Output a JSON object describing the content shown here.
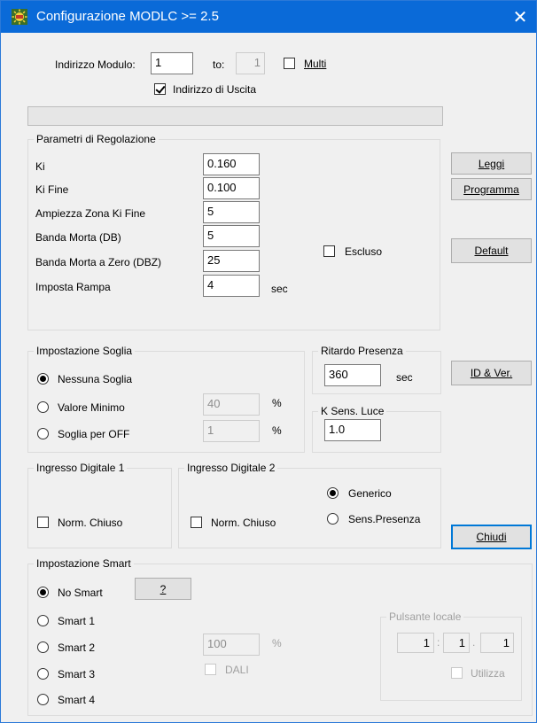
{
  "window": {
    "title": "Configurazione MODLC >= 2.5",
    "close_glyph": "✕"
  },
  "address": {
    "label": "Indirizzo Modulo:",
    "value": "1",
    "to_label": "to:",
    "to_value": "1",
    "multi_label": "Multi",
    "multi_checked": false,
    "output_label": "Indirizzo di Uscita",
    "output_checked": true
  },
  "regolazione": {
    "title": "Parametri di Regolazione",
    "params": [
      {
        "label": "Ki",
        "value": "0.160"
      },
      {
        "label": "Ki Fine",
        "value": "0.100"
      },
      {
        "label": "Ampiezza Zona Ki Fine",
        "value": "5"
      },
      {
        "label": "Banda Morta (DB)",
        "value": "5"
      },
      {
        "label": "Banda Morta a Zero (DBZ)",
        "value": "25"
      },
      {
        "label": "Imposta Rampa",
        "value": "4"
      }
    ],
    "rampa_unit": "sec",
    "escluso_label": "Escluso",
    "escluso_checked": false
  },
  "buttons": {
    "leggi": "Leggi",
    "programma": "Programma",
    "default": "Default",
    "id_ver": "ID & Ver.",
    "chiudi": "Chiudi",
    "help": "?"
  },
  "soglia": {
    "title": "Impostazione Soglia",
    "options": [
      {
        "label": "Nessuna Soglia",
        "selected": true
      },
      {
        "label": "Valore Minimo",
        "selected": false
      },
      {
        "label": "Soglia per OFF",
        "selected": false
      }
    ],
    "min_value": "40",
    "off_value": "1",
    "unit": "%"
  },
  "presenza": {
    "title": "Ritardo Presenza",
    "value": "360",
    "unit": "sec"
  },
  "luce": {
    "title": "K Sens. Luce",
    "value": "1.0"
  },
  "ingresso1": {
    "title": "Ingresso Digitale 1",
    "norm_label": "Norm. Chiuso",
    "checked": false
  },
  "ingresso2": {
    "title": "Ingresso Digitale 2",
    "norm_label": "Norm. Chiuso",
    "checked": false,
    "options": [
      {
        "label": "Generico",
        "selected": true
      },
      {
        "label": "Sens.Presenza",
        "selected": false
      }
    ]
  },
  "smart": {
    "title": "Impostazione Smart",
    "options": [
      {
        "label": "No Smart",
        "selected": true
      },
      {
        "label": "Smart 1",
        "selected": false
      },
      {
        "label": "Smart 2",
        "selected": false
      },
      {
        "label": "Smart 3",
        "selected": false
      },
      {
        "label": "Smart 4",
        "selected": false
      }
    ],
    "percent_value": "100",
    "percent_unit": "%",
    "dali_label": "DALI",
    "dali_checked": false,
    "pulsante": {
      "title": "Pulsante locale",
      "v1": "1",
      "sep1": ":",
      "v2": "1",
      "sep2": ".",
      "v3": "1",
      "utilizza_label": "Utilizza",
      "utilizza_checked": false
    }
  },
  "colors": {
    "titlebar": "#0a6ad8",
    "focus": "#0078d7",
    "face": "#f0f0f0"
  }
}
